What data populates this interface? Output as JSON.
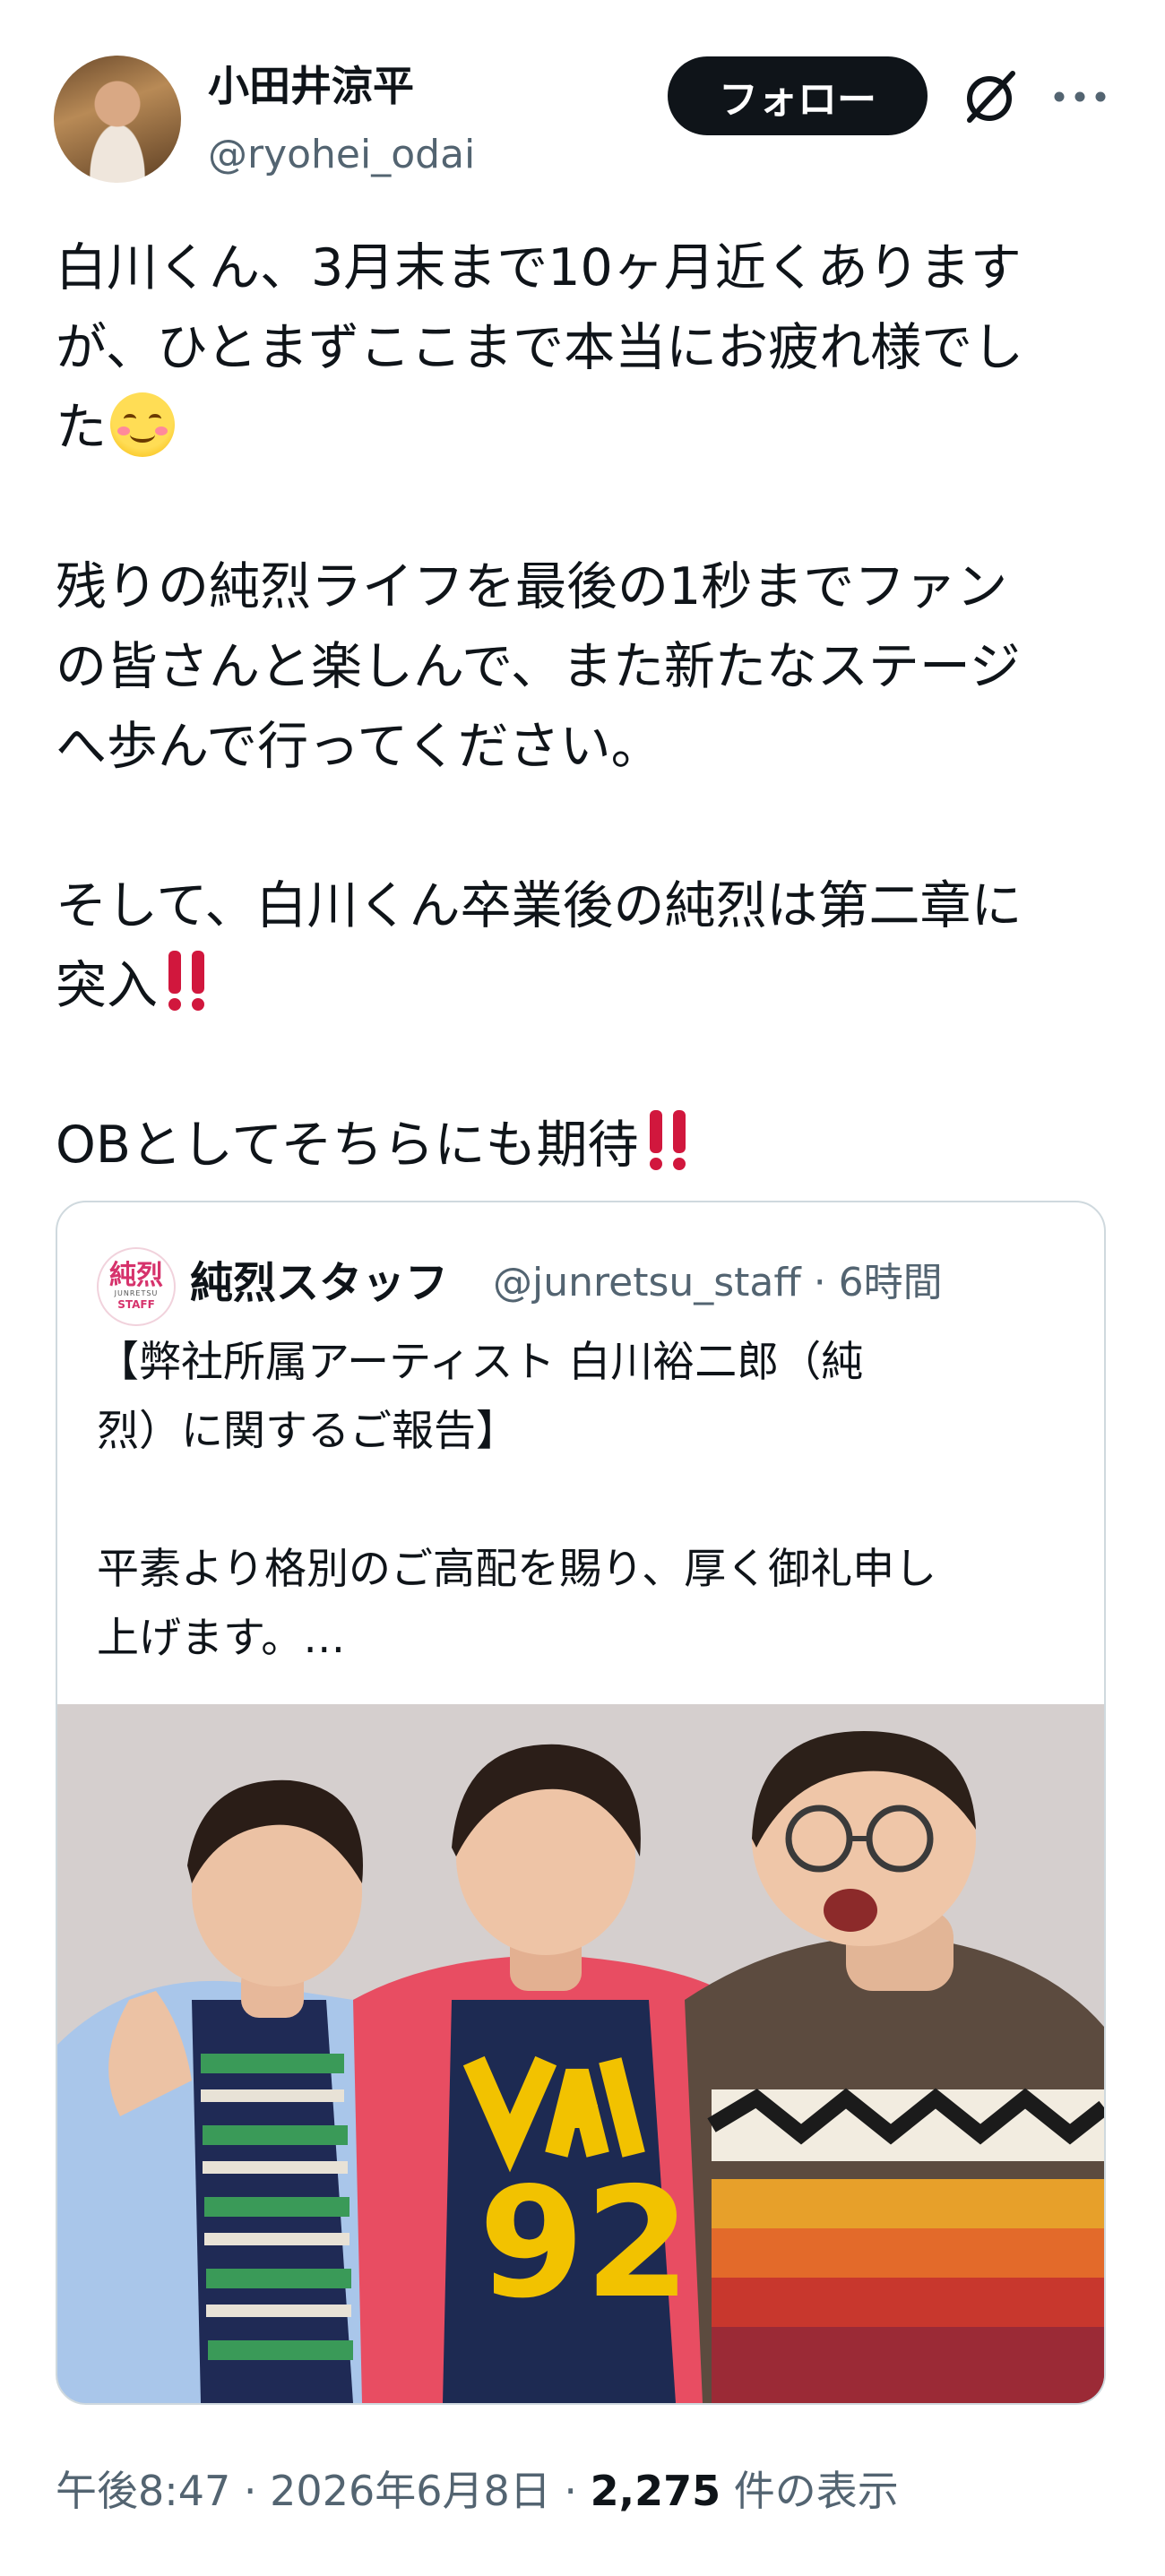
{
  "author": {
    "display_name": "小田井涼平",
    "handle": "@ryohei_odai",
    "follow_label": "フォロー"
  },
  "tweet": {
    "line1": "白川くん、3月末まで10ヶ月近くあります",
    "line2": "が、ひとまずここまで本当にお疲れ様でし",
    "line3": "た",
    "line4": "残りの純烈ライフを最後の1秒までファン",
    "line5": "の皆さんと楽しんで、また新たなステージ",
    "line6": "へ歩んで行ってください。",
    "line7": "そして、白川くん卒業後の純烈は第二章に",
    "line8": "突入",
    "line9": "OBとしてそちらにも期待"
  },
  "quote": {
    "display_name": "純烈スタッフ",
    "handle_time": "@junretsu_staff · 6時間",
    "logo_main": "純烈",
    "logo_sub": "JUNRETSU",
    "logo_staff": "STAFF",
    "text_line1": "【弊社所属アーティスト 白川裕二郎（純",
    "text_line2": "烈）に関するご報告】",
    "text_line3": "平素より格別のご高配を賜り、厚く御礼申し",
    "text_line4": "上げます。…",
    "shirt_text": "AVI 92"
  },
  "meta": {
    "time_date": "午後8:47 · 2026年6月8日 · ",
    "view_count": "2,275",
    "view_label": " 件の表示"
  },
  "icons": [
    "grok-icon",
    "more-icon",
    "smiling-face-icon",
    "double-exclamation-icon"
  ],
  "colors": {
    "text": "#0f1419",
    "secondary": "#536471",
    "exclamation": "#d1173d",
    "border": "#cfd9de"
  }
}
